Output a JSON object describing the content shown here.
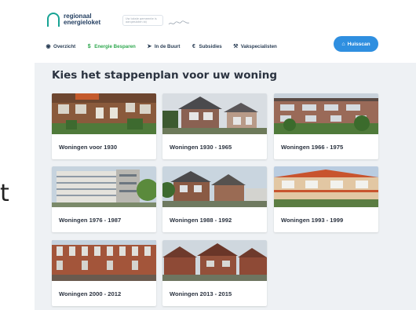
{
  "header": {
    "logo": {
      "line1": "regionaal",
      "line2": "energieloket"
    },
    "partner_text": "Uw lokale gemeente is aangesloten bij"
  },
  "nav": {
    "items": [
      {
        "label": "Overzicht",
        "icon": "globe-icon"
      },
      {
        "label": "Energie Besparen",
        "icon": "dollar-icon",
        "active": true
      },
      {
        "label": "In de Buurt",
        "icon": "send-icon"
      },
      {
        "label": "Subsidies",
        "icon": "euro-icon"
      },
      {
        "label": "Vakspecialisten",
        "icon": "wrench-icon"
      }
    ],
    "cta_label": "Huisscan",
    "cta_icon": "home-icon"
  },
  "main": {
    "title": "Kies het stappenplan voor uw woning",
    "cards": [
      {
        "label": "Woningen voor 1930"
      },
      {
        "label": "Woningen 1930 - 1965"
      },
      {
        "label": "Woningen 1966 - 1975"
      },
      {
        "label": "Woningen 1976 - 1987"
      },
      {
        "label": "Woningen 1988 - 1992"
      },
      {
        "label": "Woningen 1993 - 1999"
      },
      {
        "label": "Woningen 2000 - 2012"
      },
      {
        "label": "Woningen 2013 - 2015"
      }
    ]
  },
  "side_artifact": "t",
  "colors": {
    "brand_teal": "#17a394",
    "nav_active": "#2fa84f",
    "cta_blue": "#2f8fe0",
    "heading": "#2b3340",
    "content_bg": "#eef1f4"
  }
}
